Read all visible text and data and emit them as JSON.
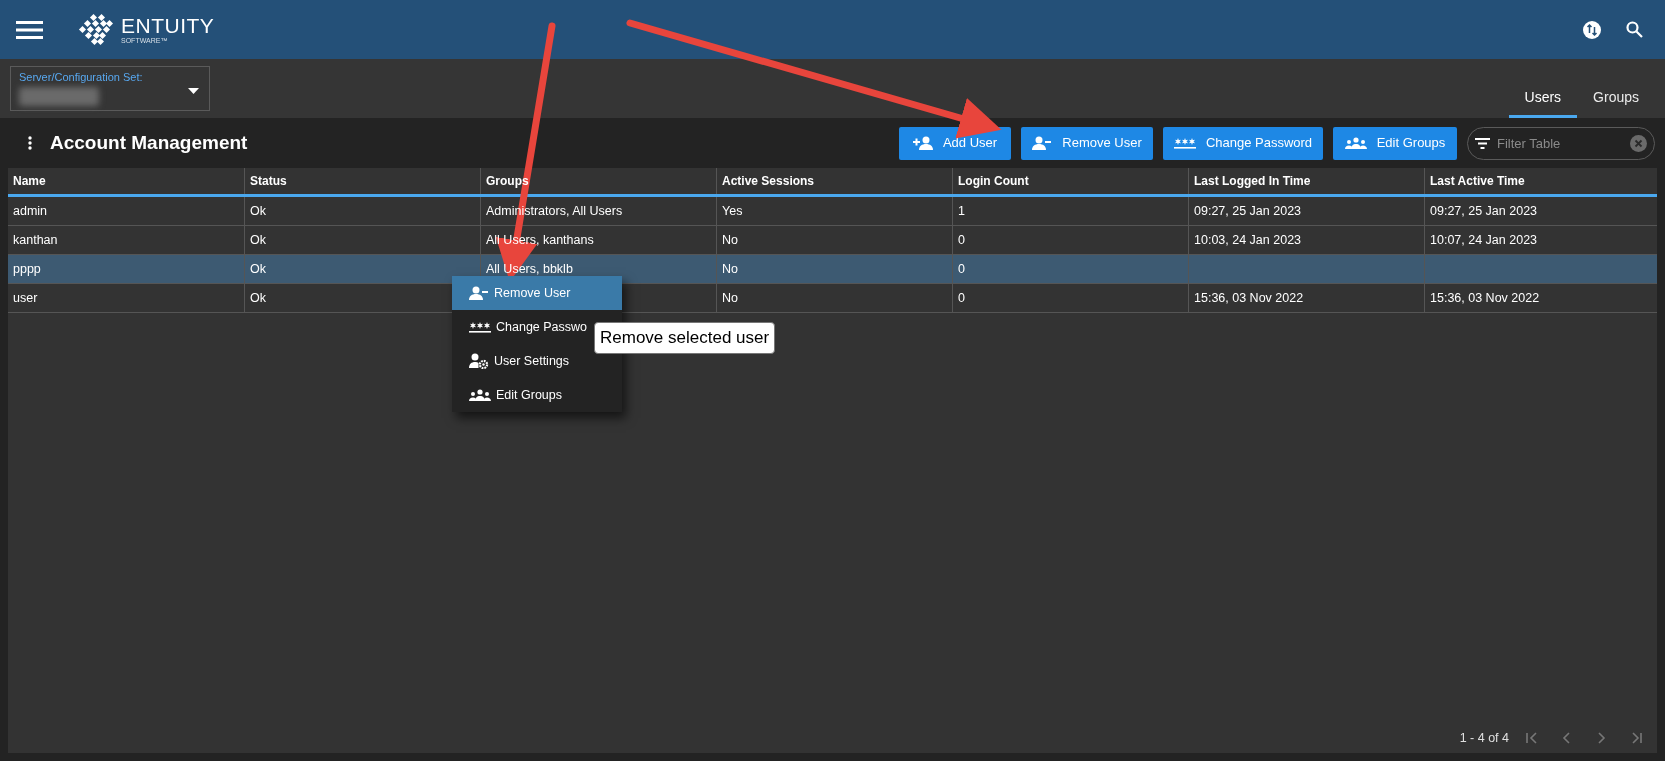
{
  "header": {
    "logo_name": "ENTUITY",
    "logo_sub": "SOFTWARE™"
  },
  "server_selector": {
    "label": "Server/Configuration Set:"
  },
  "tabs": [
    {
      "label": "Users",
      "selected": true
    },
    {
      "label": "Groups",
      "selected": false
    }
  ],
  "page_title": "Account Management",
  "toolbar_buttons": [
    {
      "label": "Add User",
      "kind": "add-user"
    },
    {
      "label": "Remove User",
      "kind": "remove-user"
    },
    {
      "label": "Change Password",
      "kind": "password"
    },
    {
      "label": "Edit Groups",
      "kind": "groups"
    }
  ],
  "filter": {
    "placeholder": "Filter Table"
  },
  "table": {
    "columns": [
      "Name",
      "Status",
      "Groups",
      "Active Sessions",
      "Login Count",
      "Last Logged In Time",
      "Last Active Time"
    ],
    "rows": [
      {
        "selected": false,
        "cells": [
          "admin",
          "Ok",
          "Administrators, All Users",
          "Yes",
          "1",
          "09:27, 25 Jan 2023",
          "09:27, 25 Jan 2023"
        ]
      },
      {
        "selected": false,
        "cells": [
          "kanthan",
          "Ok",
          "All Users, kanthans",
          "No",
          "0",
          "10:03, 24 Jan 2023",
          "10:07, 24 Jan 2023"
        ]
      },
      {
        "selected": true,
        "cells": [
          "pppp",
          "Ok",
          "All Users, bbklb",
          "No",
          "0",
          null,
          null
        ]
      },
      {
        "selected": false,
        "cells": [
          "user",
          "Ok",
          null,
          "No",
          "0",
          "15:36, 03 Nov 2022",
          "15:36, 03 Nov 2022"
        ]
      }
    ]
  },
  "context_menu": [
    {
      "label": "Remove User",
      "kind": "remove-user",
      "selected": true
    },
    {
      "label": "Change Passwo",
      "kind": "password",
      "selected": false
    },
    {
      "label": "User Settings",
      "kind": "settings",
      "selected": false
    },
    {
      "label": "Edit Groups",
      "kind": "groups",
      "selected": false
    }
  ],
  "tooltip": "Remove selected user",
  "pagination": {
    "range": "1 - 4 of 4"
  }
}
